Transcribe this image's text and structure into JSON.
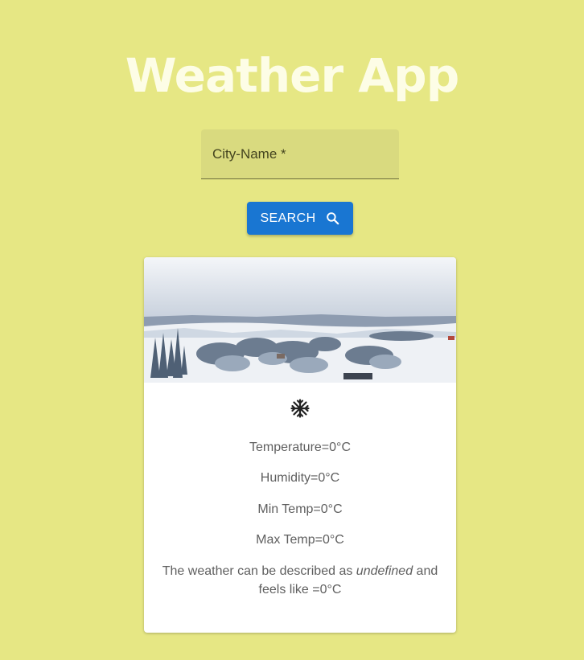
{
  "header": {
    "title": "Weather App"
  },
  "search": {
    "label": "City-Name *",
    "value": "",
    "button_label": "SEARCH",
    "button_icon": "search-icon"
  },
  "card": {
    "image_alt": "snowy landscape",
    "weather_icon": "snowflake-icon",
    "temperature": "Temperature=0°C",
    "humidity": "Humidity=0°C",
    "min_temp": "Min Temp=0°C",
    "max_temp": "Max Temp=0°C",
    "desc_prefix": "The weather can be described as",
    "desc_value": "undefined",
    "desc_suffix": "and feels like =0°C"
  },
  "colors": {
    "background": "#e6e784",
    "button": "#1976d2",
    "title": "#fdfde6"
  }
}
